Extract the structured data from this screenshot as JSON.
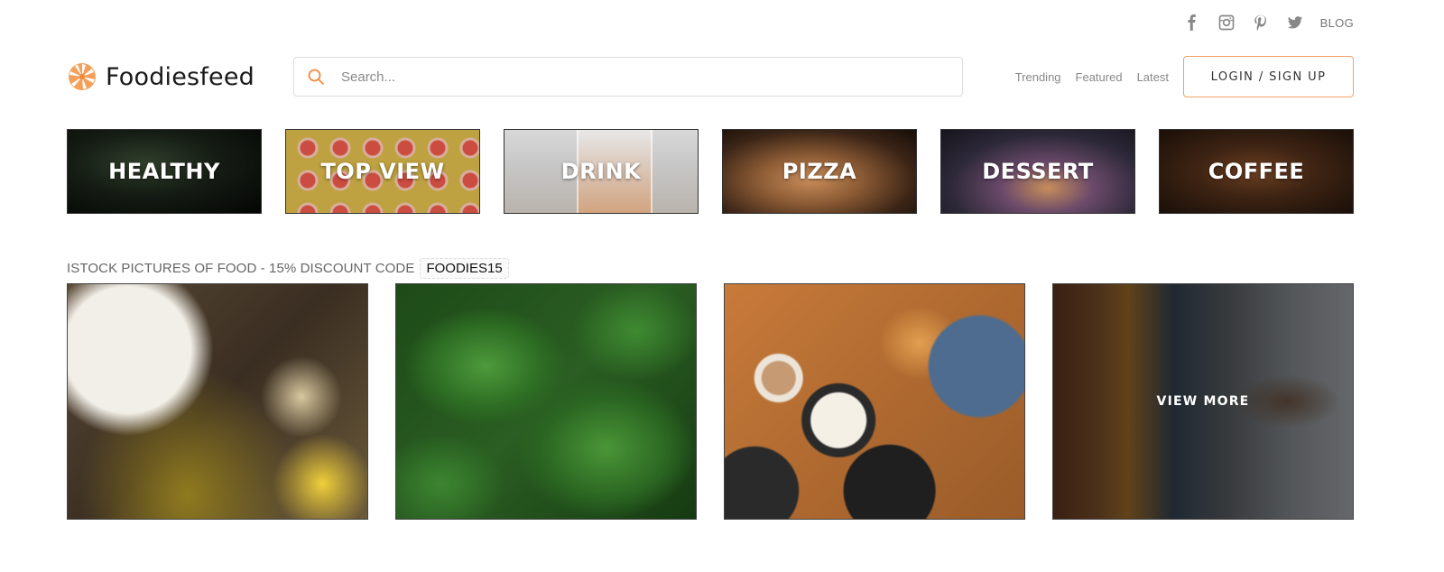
{
  "social": {
    "icons": [
      "facebook-icon",
      "instagram-icon",
      "pinterest-icon",
      "twitter-icon"
    ],
    "blog_label": "BLOG"
  },
  "header": {
    "brand": "Foodiesfeed",
    "search_placeholder": "Search...",
    "nav": [
      "Trending",
      "Featured",
      "Latest"
    ],
    "login_label": "LOGIN / SIGN UP"
  },
  "categories": [
    {
      "label": "HEALTHY"
    },
    {
      "label": "TOP VIEW"
    },
    {
      "label": "DRINK"
    },
    {
      "label": "PIZZA"
    },
    {
      "label": "DESSERT"
    },
    {
      "label": "COFFEE"
    }
  ],
  "promo": {
    "text": "ISTOCK PICTURES OF FOOD - 15% DISCOUNT CODE",
    "code": "FOODIES15"
  },
  "photos": {
    "view_more_label": "VIEW MORE"
  },
  "colors": {
    "accent": "#f08a3c",
    "login_border": "#f0a06a",
    "text_muted": "#888888"
  }
}
